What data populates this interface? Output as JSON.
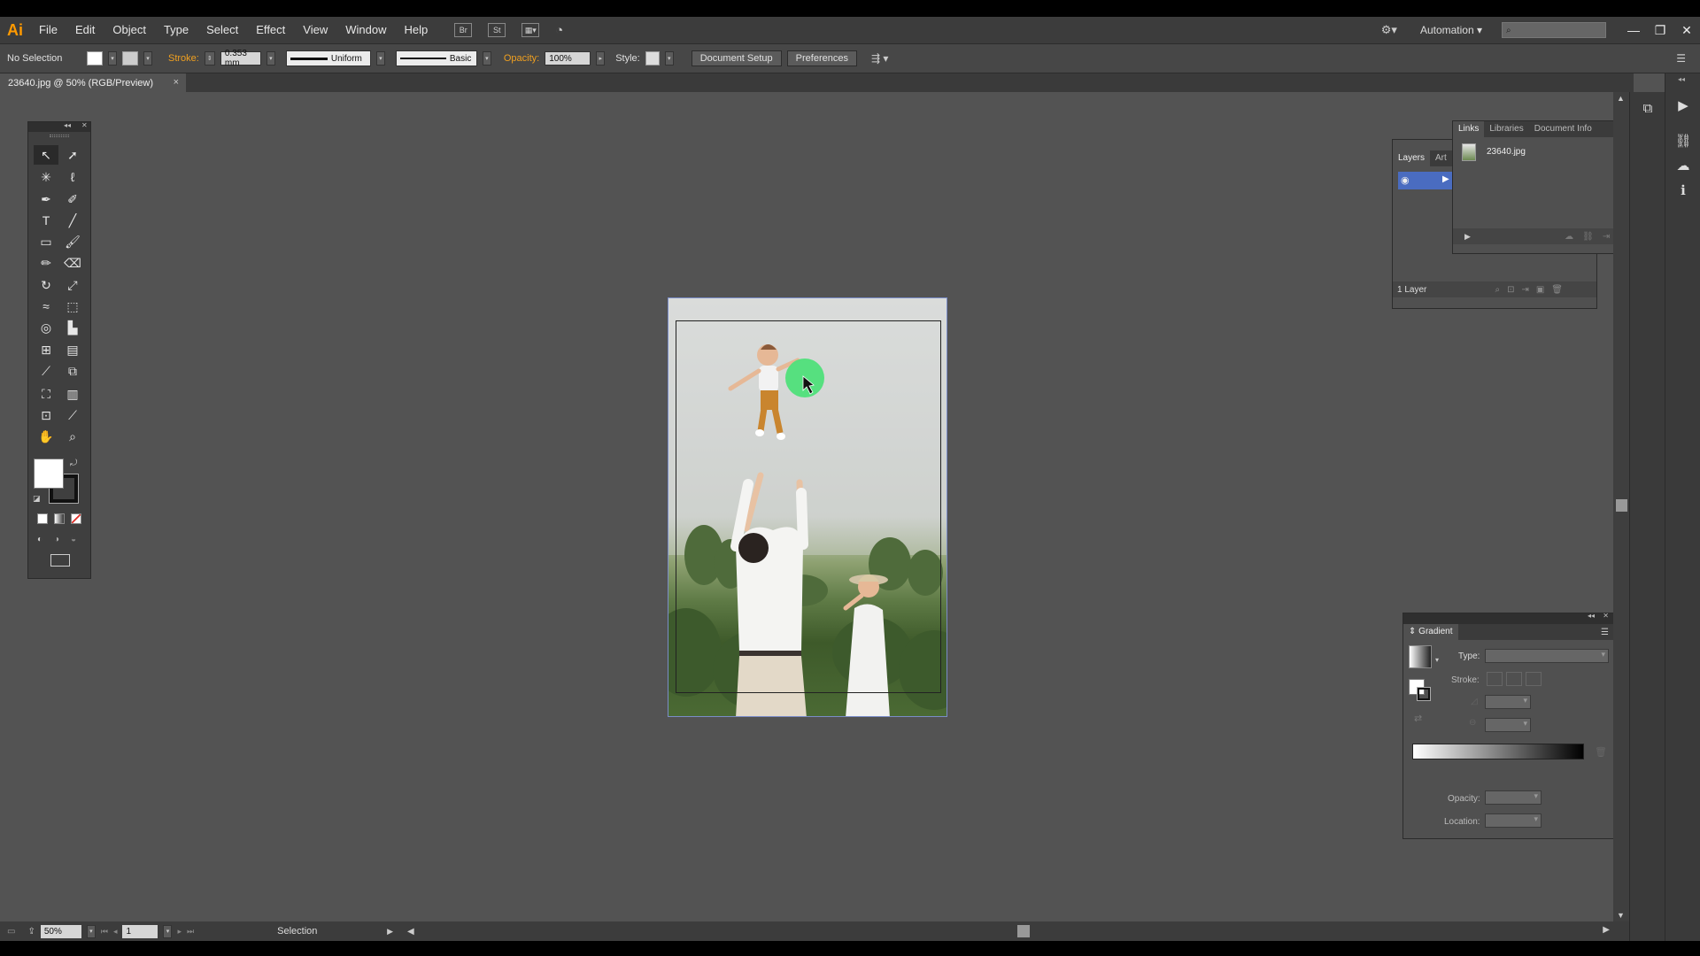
{
  "app": {
    "logo": "Ai",
    "menu": [
      "File",
      "Edit",
      "Object",
      "Type",
      "Select",
      "Effect",
      "View",
      "Window",
      "Help"
    ],
    "workspace": "Automation",
    "search_placeholder": ""
  },
  "control_bar": {
    "selection_label": "No Selection",
    "stroke_label": "Stroke:",
    "stroke_weight": "0.353 mm",
    "profile": "Uniform",
    "brush": "Basic",
    "opacity_label": "Opacity:",
    "opacity_value": "100%",
    "style_label": "Style:",
    "document_setup": "Document Setup",
    "preferences": "Preferences"
  },
  "document": {
    "tab_title": "23640.jpg @ 50% (RGB/Preview)"
  },
  "status_bar": {
    "zoom": "50%",
    "artboard": "1",
    "tool_status": "Selection"
  },
  "layers_panel": {
    "tabs": [
      "Layers",
      "Art"
    ],
    "footer": "1 Layer"
  },
  "links_panel": {
    "tabs": [
      "Links",
      "Libraries",
      "Document Info"
    ],
    "items": [
      {
        "name": "23640.jpg"
      }
    ]
  },
  "gradient_panel": {
    "title": "Gradient",
    "type_label": "Type:",
    "stroke_label": "Stroke:",
    "opacity_label": "Opacity:",
    "location_label": "Location:"
  },
  "colors": {
    "canvas": "#535353",
    "highlight": "#4fe07a"
  }
}
